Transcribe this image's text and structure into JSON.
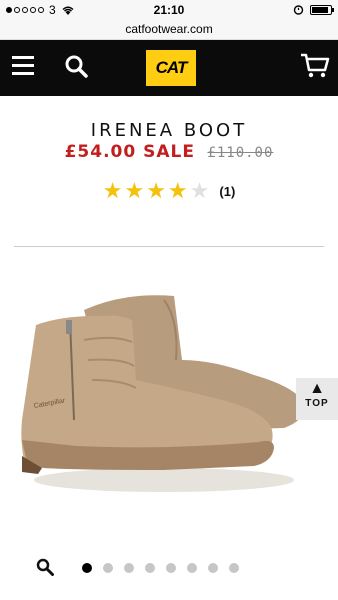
{
  "status_bar": {
    "carrier": "3",
    "time": "21:10",
    "signal_bars_filled": 1,
    "signal_bars_total": 5,
    "battery_level": 0.9
  },
  "browser": {
    "url": "catfootwear.com"
  },
  "header": {
    "logo_text": "CAT",
    "colors": {
      "background": "#0b0b0b",
      "logo": "#ffcd11"
    },
    "icons": [
      "menu-icon",
      "search-icon",
      "cart-icon"
    ]
  },
  "product": {
    "title": "IRENEA BOOT",
    "sale_price": "£54.00 SALE",
    "original_price": "£110.00",
    "sale_color": "#c21e1e",
    "rating": 4,
    "rating_max": 5,
    "review_count": "(1)"
  },
  "back_to_top": {
    "label": "TOP"
  },
  "carousel": {
    "total": 8,
    "active_index": 0
  }
}
